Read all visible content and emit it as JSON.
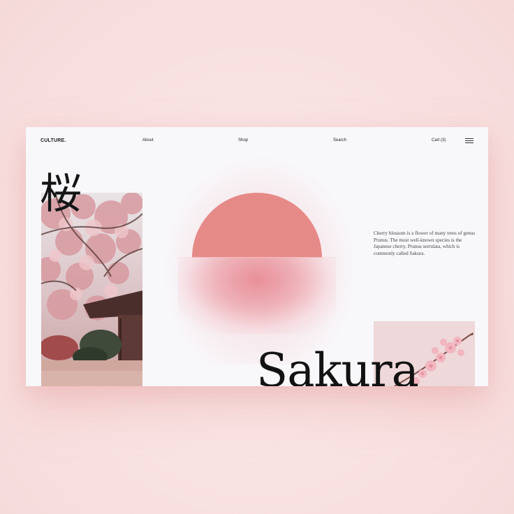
{
  "nav": {
    "brand": "CULTURE.",
    "links": [
      "About",
      "Shop",
      "Search",
      "Cart (3)"
    ],
    "menu_icon": "hamburger-menu-icon"
  },
  "hero": {
    "kanji": "桜",
    "title": "Sakura",
    "description": "Cherry blossom is a flower of many trees of genus Prunus. The most well-known species is the Japanese cherry, Prunus serrulata, which is commonly called Sakura."
  },
  "colors": {
    "background": "#f9e3e3",
    "card": "#f8f7fa",
    "sun": "#e68a88",
    "text": "#121212"
  }
}
